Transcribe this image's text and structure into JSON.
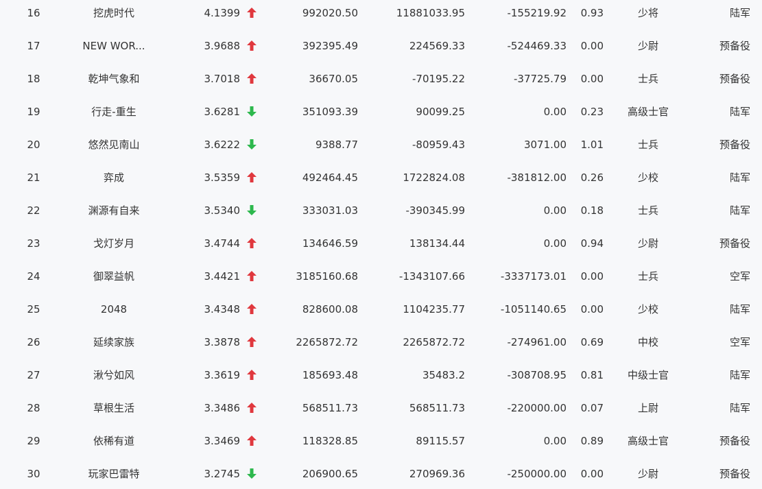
{
  "colors": {
    "up": "#e0383e",
    "down": "#2db84d",
    "text": "#333333",
    "background": "#f7f8fa"
  },
  "rows": [
    {
      "rank": "16",
      "name": "挖虎时代",
      "score": "4.1399",
      "trend": "up",
      "v1": "992020.50",
      "v2": "11881033.95",
      "v3": "-155219.92",
      "ratio": "0.93",
      "rank_title": "少将",
      "branch": "陆军"
    },
    {
      "rank": "17",
      "name": "NEW WOR...",
      "score": "3.9688",
      "trend": "up",
      "v1": "392395.49",
      "v2": "224569.33",
      "v3": "-524469.33",
      "ratio": "0.00",
      "rank_title": "少尉",
      "branch": "预备役"
    },
    {
      "rank": "18",
      "name": "乾坤气象和",
      "score": "3.7018",
      "trend": "up",
      "v1": "36670.05",
      "v2": "-70195.22",
      "v3": "-37725.79",
      "ratio": "0.00",
      "rank_title": "士兵",
      "branch": "预备役"
    },
    {
      "rank": "19",
      "name": "行走-重生",
      "score": "3.6281",
      "trend": "down",
      "v1": "351093.39",
      "v2": "90099.25",
      "v3": "0.00",
      "ratio": "0.23",
      "rank_title": "高级士官",
      "branch": "陆军"
    },
    {
      "rank": "20",
      "name": "悠然见南山",
      "score": "3.6222",
      "trend": "down",
      "v1": "9388.77",
      "v2": "-80959.43",
      "v3": "3071.00",
      "ratio": "1.01",
      "rank_title": "士兵",
      "branch": "预备役"
    },
    {
      "rank": "21",
      "name": "弈成",
      "score": "3.5359",
      "trend": "up",
      "v1": "492464.45",
      "v2": "1722824.08",
      "v3": "-381812.00",
      "ratio": "0.26",
      "rank_title": "少校",
      "branch": "陆军"
    },
    {
      "rank": "22",
      "name": "渊源有自来",
      "score": "3.5340",
      "trend": "down",
      "v1": "333031.03",
      "v2": "-390345.99",
      "v3": "0.00",
      "ratio": "0.18",
      "rank_title": "士兵",
      "branch": "陆军"
    },
    {
      "rank": "23",
      "name": "戈灯岁月",
      "score": "3.4744",
      "trend": "up",
      "v1": "134646.59",
      "v2": "138134.44",
      "v3": "0.00",
      "ratio": "0.94",
      "rank_title": "少尉",
      "branch": "预备役"
    },
    {
      "rank": "24",
      "name": "御翠益帆",
      "score": "3.4421",
      "trend": "up",
      "v1": "3185160.68",
      "v2": "-1343107.66",
      "v3": "-3337173.01",
      "ratio": "0.00",
      "rank_title": "士兵",
      "branch": "空军"
    },
    {
      "rank": "25",
      "name": "2048",
      "score": "3.4348",
      "trend": "up",
      "v1": "828600.08",
      "v2": "1104235.77",
      "v3": "-1051140.65",
      "ratio": "0.00",
      "rank_title": "少校",
      "branch": "陆军"
    },
    {
      "rank": "26",
      "name": "延续家族",
      "score": "3.3878",
      "trend": "up",
      "v1": "2265872.72",
      "v2": "2265872.72",
      "v3": "-274961.00",
      "ratio": "0.69",
      "rank_title": "中校",
      "branch": "空军"
    },
    {
      "rank": "27",
      "name": "湫兮如风",
      "score": "3.3619",
      "trend": "up",
      "v1": "185693.48",
      "v2": "35483.2",
      "v3": "-308708.95",
      "ratio": "0.81",
      "rank_title": "中级士官",
      "branch": "陆军"
    },
    {
      "rank": "28",
      "name": "草根生活",
      "score": "3.3486",
      "trend": "up",
      "v1": "568511.73",
      "v2": "568511.73",
      "v3": "-220000.00",
      "ratio": "0.07",
      "rank_title": "上尉",
      "branch": "陆军"
    },
    {
      "rank": "29",
      "name": "依稀有道",
      "score": "3.3469",
      "trend": "up",
      "v1": "118328.85",
      "v2": "89115.57",
      "v3": "0.00",
      "ratio": "0.89",
      "rank_title": "高级士官",
      "branch": "预备役"
    },
    {
      "rank": "30",
      "name": "玩家巴雷特",
      "score": "3.2745",
      "trend": "down",
      "v1": "206900.65",
      "v2": "270969.36",
      "v3": "-250000.00",
      "ratio": "0.00",
      "rank_title": "少尉",
      "branch": "预备役"
    }
  ]
}
